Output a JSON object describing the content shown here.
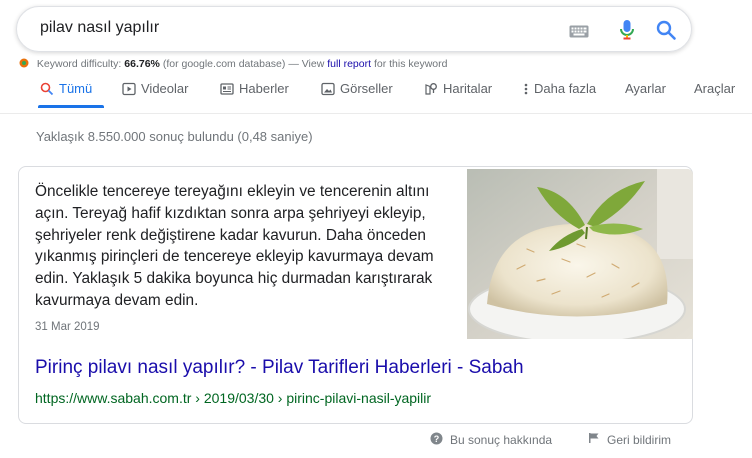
{
  "search": {
    "query": "pilav nasıl yapılır",
    "keyboard_icon": "keyboard-icon",
    "mic_icon": "microphone-icon",
    "search_icon": "search-icon"
  },
  "keyword_bar": {
    "label": "Keyword difficulty:",
    "value": "66.76%",
    "database": "(for google.com database) — View",
    "link": "full report",
    "suffix": "for this keyword"
  },
  "tabs": [
    {
      "label": "Tümü",
      "icon": "search-icon",
      "active": true
    },
    {
      "label": "Videolar",
      "icon": "play-icon"
    },
    {
      "label": "Haberler",
      "icon": "news-icon"
    },
    {
      "label": "Görseller",
      "icon": "image-icon"
    },
    {
      "label": "Haritalar",
      "icon": "map-pin-icon"
    },
    {
      "label": "Daha fazla",
      "icon": "more-vert-icon"
    },
    {
      "label": "Ayarlar"
    },
    {
      "label": "Araçlar"
    }
  ],
  "result_stats": "Yaklaşık 8.550.000 sonuç bulundu (0,48 saniye)",
  "featured_snippet": {
    "text": "Öncelikle tencereye tereyağını ekleyin ve tencerenin altını açın. Tereyağ hafif kızdıktan sonra arpa şehriyeyi ekleyip, şehriyeler renk değiştirene kadar kavurun. Daha önceden yıkanmış pirinçleri de tencereye ekleyip kavurmaya devam edin. Yaklaşık 5 dakika boyunca hiç durmadan karıştırarak kavurmaya devam edin.",
    "date": "31 Mar 2019",
    "title": "Pirinç pilavı nasıl yapılır? - Pilav Tarifleri Haberleri - Sabah",
    "url": "https://www.sabah.com.tr › 2019/03/30 › pirinc-pilavi-nasil-yapilir"
  },
  "footer": {
    "about": "Bu sonuç hakkında",
    "feedback": "Geri bildirim"
  },
  "colors": {
    "link_blue": "#1a0dab",
    "url_green": "#006621",
    "accent": "#1a73e8"
  }
}
